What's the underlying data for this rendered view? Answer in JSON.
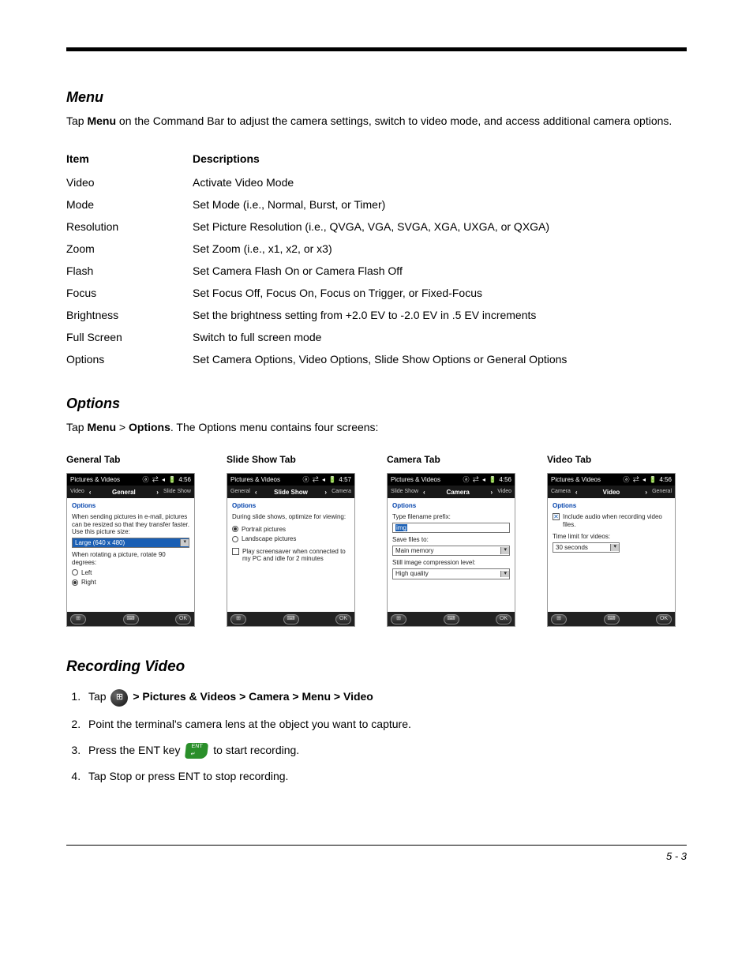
{
  "sections": {
    "menu": {
      "title": "Menu",
      "intro_pre": "Tap ",
      "intro_bold": "Menu",
      "intro_post": " on the Command Bar to adjust the camera settings, switch to video mode, and access additional camera options.",
      "headers": {
        "item": "Item",
        "desc": "Descriptions"
      },
      "rows": [
        {
          "item": "Video",
          "desc": "Activate Video Mode"
        },
        {
          "item": "Mode",
          "desc": "Set Mode (i.e., Normal, Burst, or Timer)"
        },
        {
          "item": "Resolution",
          "desc": "Set Picture Resolution (i.e., QVGA, VGA, SVGA, XGA, UXGA, or QXGA)"
        },
        {
          "item": "Zoom",
          "desc": "Set Zoom (i.e., x1, x2, or x3)"
        },
        {
          "item": "Flash",
          "desc": "Set Camera Flash On or Camera Flash Off"
        },
        {
          "item": "Focus",
          "desc": "Set Focus Off, Focus On, Focus on Trigger, or Fixed-Focus"
        },
        {
          "item": "Brightness",
          "desc": "Set the brightness setting from +2.0 EV to -2.0 EV in .5 EV increments"
        },
        {
          "item": "Full Screen",
          "desc": "Switch to full screen mode"
        },
        {
          "item": "Options",
          "desc": "Set Camera Options, Video Options, Slide Show Options or General Options"
        }
      ]
    },
    "options": {
      "title": "Options",
      "intro_pre": "Tap ",
      "intro_b1": "Menu",
      "intro_gt": " > ",
      "intro_b2": "Options",
      "intro_post": ". The Options menu contains four screens:",
      "tabs": {
        "general": {
          "label": "General Tab",
          "title": "Pictures & Videos",
          "time": "4:56",
          "nav_left": "Video",
          "nav_center": "General",
          "nav_right": "Slide Show",
          "options_word": "Options",
          "text1": "When sending pictures in e-mail, pictures can be resized so that they transfer faster. Use this picture size:",
          "dropdown1": "Large (640 x 480)",
          "text2": "When rotating a picture, rotate 90 degrees:",
          "radio_left": "Left",
          "radio_right": "Right"
        },
        "slideshow": {
          "label": "Slide Show Tab",
          "title": "Pictures & Videos",
          "time": "4:57",
          "nav_left": "General",
          "nav_center": "Slide Show",
          "nav_right": "Camera",
          "options_word": "Options",
          "text1": "During slide shows, optimize for viewing:",
          "radio_portrait": "Portrait pictures",
          "radio_landscape": "Landscape pictures",
          "check_text": "Play screensaver when connected to my PC and idle for 2 minutes"
        },
        "camera": {
          "label": "Camera Tab",
          "title": "Pictures & Videos",
          "time": "4:56",
          "nav_left": "Slide Show",
          "nav_center": "Camera",
          "nav_right": "Video",
          "options_word": "Options",
          "text1": "Type filename prefix:",
          "field1": "img",
          "text2": "Save files to:",
          "dropdown2": "Main memory",
          "text3": "Still image compression level:",
          "dropdown3": "High quality"
        },
        "video": {
          "label": "Video Tab",
          "title": "Pictures & Videos",
          "time": "4:56",
          "nav_left": "Camera",
          "nav_center": "Video",
          "nav_right": "General",
          "options_word": "Options",
          "check1": "Include audio when recording video files.",
          "text1": "Time limit for videos:",
          "dropdown1": "30 seconds"
        }
      },
      "ok_label": "OK"
    },
    "recording": {
      "title": "Recording Video",
      "step1_pre": "Tap ",
      "step1_bold": " > Pictures & Videos > Camera > Menu > Video",
      "step2": "Point the terminal's camera lens at the object you want to capture.",
      "step3_pre": "Press the ENT key ",
      "step3_post": " to start recording.",
      "step4": "Tap Stop or press ENT to stop recording.",
      "ent_label": "ENT\n↵"
    }
  },
  "status_icons": "ⓐ ⇄ ◂ 🔋",
  "page_number": "5 - 3"
}
